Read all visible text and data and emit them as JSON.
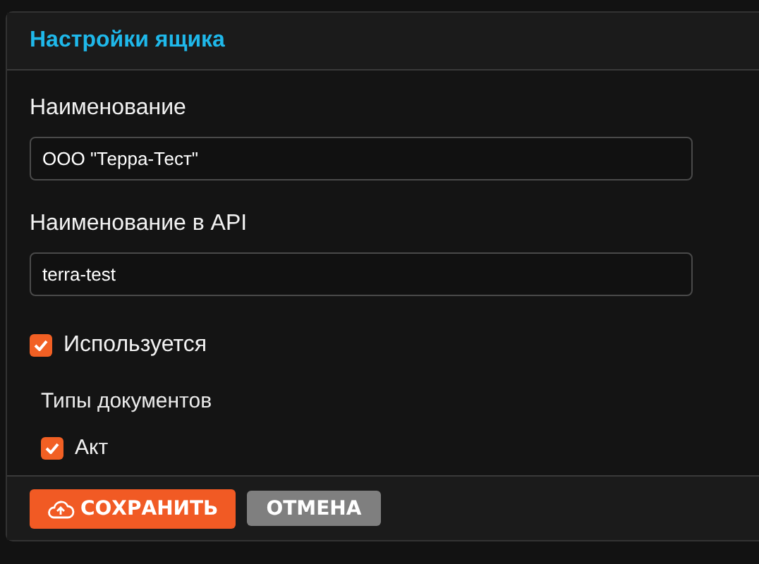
{
  "card": {
    "title": "Настройки ящика"
  },
  "fields": [
    {
      "label": "Наименование",
      "value": "ООО \"Терра-Тест\""
    },
    {
      "label": "Наименование в API",
      "value": "terra-test"
    }
  ],
  "in_use": {
    "label": "Используется",
    "checked": true
  },
  "document_types": {
    "label": "Типы документов",
    "items": [
      {
        "label": "Акт",
        "checked": true
      }
    ]
  },
  "buttons": [
    {
      "kind": "save",
      "label": "СОХРАНИТЬ"
    },
    {
      "kind": "cancel",
      "label": "ОТМЕНА"
    }
  ]
}
